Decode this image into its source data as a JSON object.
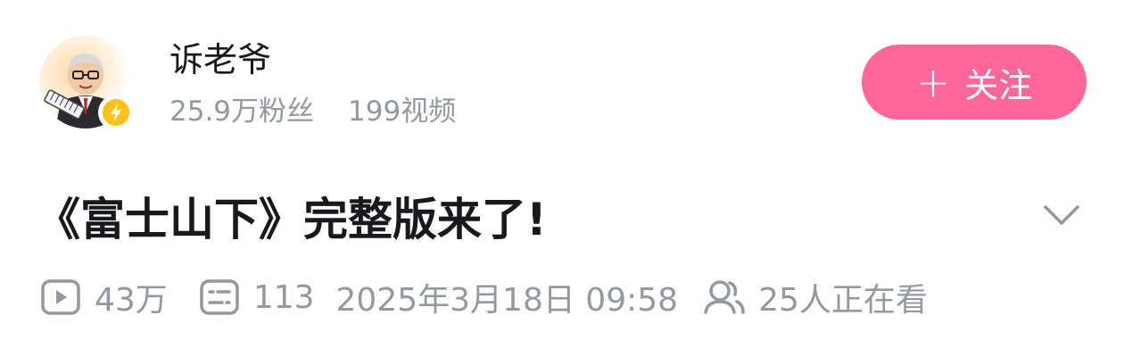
{
  "uploader": {
    "name": "诉老爷",
    "followers": "25.9万粉丝",
    "videos": "199视频",
    "verified_badge_color": "#ffc21a",
    "avatar_icon": "avatar-cartoon-man"
  },
  "follow_button": {
    "plus": "+",
    "label": "关注",
    "color": "#ff6699"
  },
  "video": {
    "title": "《富士山下》完整版来了!",
    "expand_icon": "chevron-down-icon"
  },
  "meta": {
    "views_icon": "play-icon",
    "views": "43万",
    "danmaku_icon": "danmaku-icon",
    "danmaku": "113",
    "published": "2025年3月18日 09:58",
    "watching_icon": "people-icon",
    "watching": "25人正在看"
  }
}
